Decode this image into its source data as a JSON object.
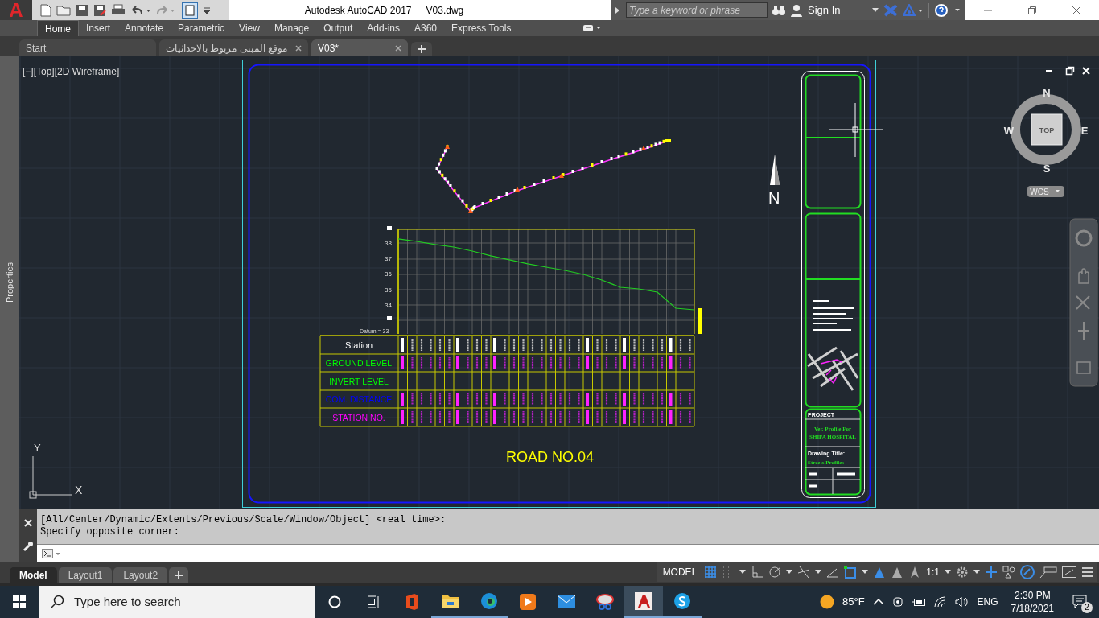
{
  "title_bar": {
    "logo": "A",
    "title": "Autodesk AutoCAD 2017",
    "file": "V03.dwg",
    "search_placeholder": "Type a keyword or phrase",
    "sign_in": "Sign In"
  },
  "ribbon_tabs": [
    {
      "label": "Home",
      "selected": true
    },
    {
      "label": "Insert",
      "selected": false
    },
    {
      "label": "Annotate",
      "selected": false
    },
    {
      "label": "Parametric",
      "selected": false
    },
    {
      "label": "View",
      "selected": false
    },
    {
      "label": "Manage",
      "selected": false
    },
    {
      "label": "Output",
      "selected": false
    },
    {
      "label": "Add-ins",
      "selected": false
    },
    {
      "label": "A360",
      "selected": false
    },
    {
      "label": "Express Tools",
      "selected": false
    }
  ],
  "file_tabs": [
    {
      "label": "Start",
      "selected": false,
      "closable": false
    },
    {
      "label": "موقع المبنى مربوط بالاحداثيات",
      "selected": false,
      "closable": true
    },
    {
      "label": "V03*",
      "selected": true,
      "closable": true
    }
  ],
  "palette": {
    "label": "Properties"
  },
  "viewport": {
    "label": "[−][Top][2D Wireframe]"
  },
  "drawing": {
    "north": "N",
    "profile": {
      "chart_data": {
        "type": "line",
        "yticks": [
          38,
          37,
          36,
          35,
          34
        ],
        "ylim": [
          32.13,
          38.88
        ],
        "series": [
          {
            "color": "#22cc22",
            "values": [
              38.26,
              38.1,
              37.9,
              37.74,
              37.48,
              37.17,
              36.91,
              36.65,
              36.44,
              36.23,
              35.97,
              35.61,
              35.14,
              35.04,
              34.83,
              33.79,
              33.69
            ]
          }
        ]
      },
      "datum": "Datum = 33",
      "rows": [
        {
          "label": "Station",
          "color": "#ffffff"
        },
        {
          "label": "GROUND LEVEL",
          "color": "#00ff00"
        },
        {
          "label": "INVERT LEVEL",
          "color": "#00ff00"
        },
        {
          "label": "COM. DISTANCE",
          "color": "#0000ff"
        },
        {
          "label": "STATION NO.",
          "color": "#ff00ff"
        }
      ]
    },
    "road_title": "ROAD NO.04",
    "title_block": {
      "project_label": "PROJECT",
      "project_lines": [
        "Ver. Profile For",
        "SHIFA HOSPITAL"
      ],
      "drawing_title_label": "Drawing Title:",
      "drawing_title": "Streets Profiles"
    }
  },
  "ucs": {
    "y": "Y",
    "x": "X"
  },
  "viewcube": {
    "top": "TOP",
    "n": "N",
    "s": "S",
    "e": "E",
    "w": "W",
    "coords": "WCS"
  },
  "command_line": {
    "history": [
      "[All/Center/Dynamic/Extents/Previous/Scale/Window/Object] <real time>:",
      "Specify opposite corner:"
    ]
  },
  "layout_tabs": [
    {
      "label": "Model",
      "selected": true
    },
    {
      "label": "Layout1",
      "selected": false
    },
    {
      "label": "Layout2",
      "selected": false
    }
  ],
  "status_bar": {
    "space": "MODEL",
    "scale": "1:1"
  },
  "taskbar": {
    "search_placeholder": "Type here to search",
    "temperature": "85°F",
    "language": "ENG",
    "time": "2:30 PM",
    "date": "7/18/2021",
    "notifications": "2"
  }
}
